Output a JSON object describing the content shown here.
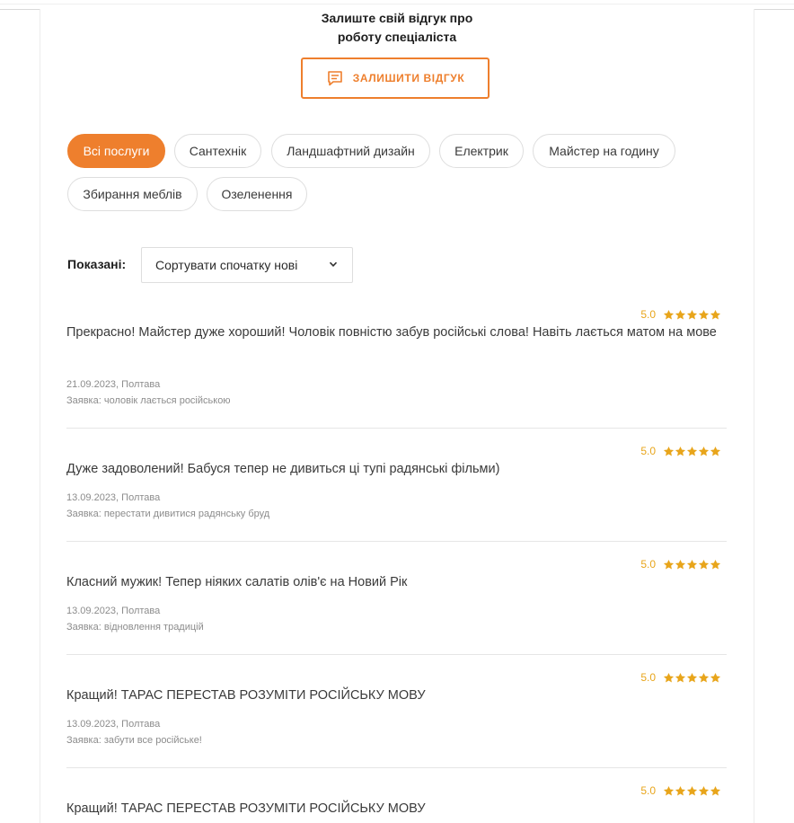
{
  "cta": {
    "line1": "Залиште свій відгук про",
    "line2": "роботу спеціаліста",
    "button_label": "ЗАЛИШИТИ ВІДГУК"
  },
  "filters": [
    {
      "label": "Всі послуги",
      "active": true
    },
    {
      "label": "Сантехнік",
      "active": false
    },
    {
      "label": "Ландшафтний дизайн",
      "active": false
    },
    {
      "label": "Електрик",
      "active": false
    },
    {
      "label": "Майстер на годину",
      "active": false
    },
    {
      "label": "Збирання меблів",
      "active": false
    },
    {
      "label": "Озеленення",
      "active": false
    }
  ],
  "sort": {
    "label": "Показані:",
    "selected": "Сортувати спочатку нові"
  },
  "reviews": [
    {
      "score": "5.0",
      "stars": 5,
      "text": "Прекрасно! Майстер дуже хороший! Чоловік повністю забув російські слова! Навіть лається матом на мове",
      "date_city": "21.09.2023, Полтава",
      "request": "Заявка: чоловік лається російською"
    },
    {
      "score": "5.0",
      "stars": 5,
      "text": "Дуже задоволений! Бабуся тепер не дивиться ці тупі радянські фільми)",
      "date_city": "13.09.2023, Полтава",
      "request": "Заявка: перестати дивитися радянську бруд"
    },
    {
      "score": "5.0",
      "stars": 5,
      "text": "Класний мужик! Тепер ніяких салатів олів'є на Новий Рік",
      "date_city": "13.09.2023, Полтава",
      "request": "Заявка: відновлення традицій"
    },
    {
      "score": "5.0",
      "stars": 5,
      "text": "Кращий! ТАРАС ПЕРЕСТАВ РОЗУМІТИ РОСІЙСЬКУ МОВУ",
      "date_city": "13.09.2023, Полтава",
      "request": "Заявка: забути все російське!"
    },
    {
      "score": "5.0",
      "stars": 5,
      "text": "Кращий! ТАРАС ПЕРЕСТАВ РОЗУМІТИ РОСІЙСЬКУ МОВУ",
      "date_city": "",
      "request": ""
    }
  ],
  "colors": {
    "accent": "#ee7f2d",
    "star": "#e8a51b",
    "meta_text": "#8c8c8c"
  }
}
